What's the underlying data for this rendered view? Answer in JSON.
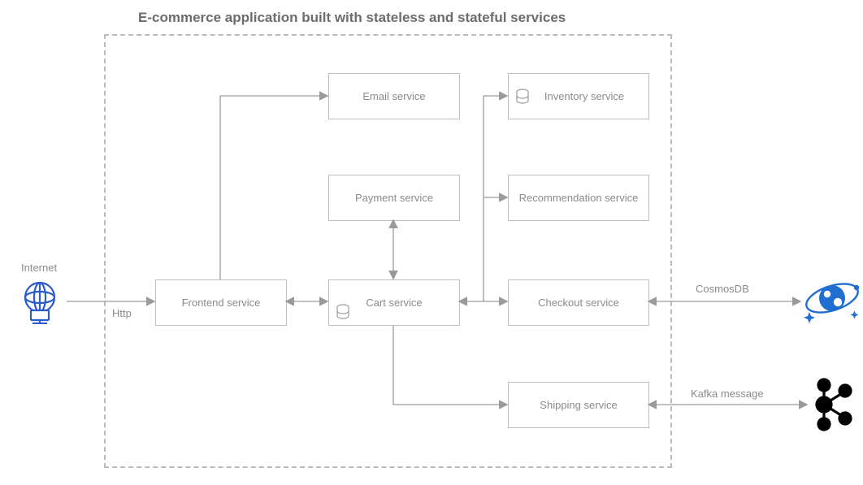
{
  "title": "E-commerce application built with stateless and stateful services",
  "labels": {
    "internet": "Internet",
    "http": "Http",
    "cosmosdb": "CosmosDB",
    "kafka": "Kafka message"
  },
  "services": {
    "frontend": "Frontend service",
    "email": "Email service",
    "payment": "Payment service",
    "cart": "Cart service",
    "inventory": "Inventory service",
    "recommendation": "Recommendation service",
    "checkout": "Checkout service",
    "shipping": "Shipping service"
  },
  "icons": {
    "internet": "globe-icon",
    "cosmosdb": "cosmosdb-icon",
    "kafka": "kafka-icon",
    "db": "database-icon"
  },
  "connections": [
    {
      "from": "internet",
      "to": "frontend",
      "label": "Http",
      "type": "uni"
    },
    {
      "from": "frontend",
      "to": "email",
      "type": "uni"
    },
    {
      "from": "frontend",
      "to": "cart",
      "type": "bi"
    },
    {
      "from": "cart",
      "to": "payment",
      "type": "bi"
    },
    {
      "from": "cart",
      "to": "shipping",
      "type": "uni"
    },
    {
      "from": "cart",
      "to": "checkout",
      "type": "bi"
    },
    {
      "from": "checkout",
      "to": "inventory",
      "type": "uni"
    },
    {
      "from": "checkout",
      "to": "recommendation",
      "type": "uni"
    },
    {
      "from": "checkout",
      "to": "cosmosdb",
      "label": "CosmosDB",
      "type": "bi"
    },
    {
      "from": "shipping",
      "to": "kafka",
      "label": "Kafka message",
      "type": "bi"
    }
  ]
}
